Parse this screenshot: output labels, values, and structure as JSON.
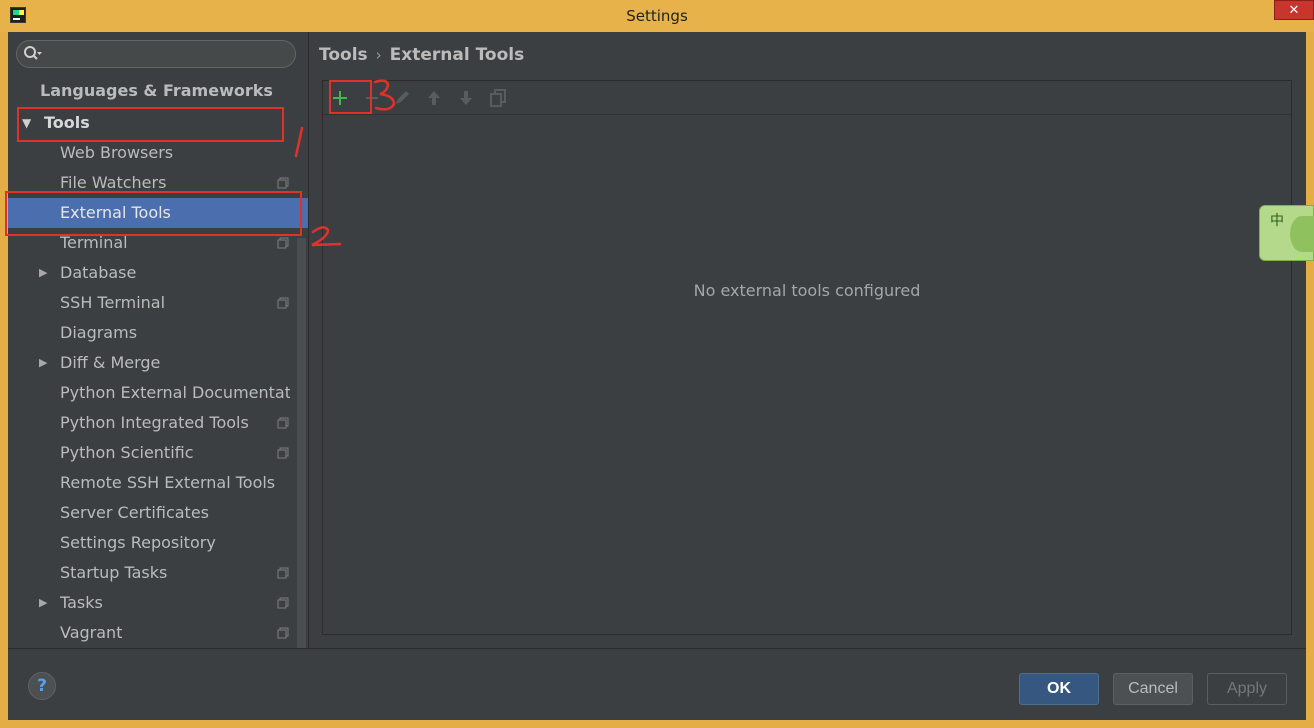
{
  "window": {
    "title": "Settings",
    "close_glyph": "✕"
  },
  "search": {
    "value": ""
  },
  "breadcrumb": {
    "parent": "Tools",
    "separator": "›",
    "current": "External Tools"
  },
  "tree": {
    "languages": "Languages & Frameworks",
    "tools": "Tools",
    "items": [
      {
        "label": "Web Browsers"
      },
      {
        "label": "File Watchers"
      },
      {
        "label": "External Tools"
      },
      {
        "label": "Terminal"
      },
      {
        "label": "Database"
      },
      {
        "label": "SSH Terminal"
      },
      {
        "label": "Diagrams"
      },
      {
        "label": "Diff & Merge"
      },
      {
        "label": "Python External Documentatic"
      },
      {
        "label": "Python Integrated Tools"
      },
      {
        "label": "Python Scientific"
      },
      {
        "label": "Remote SSH External Tools"
      },
      {
        "label": "Server Certificates"
      },
      {
        "label": "Settings Repository"
      },
      {
        "label": "Startup Tasks"
      },
      {
        "label": "Tasks"
      },
      {
        "label": "Vagrant"
      }
    ]
  },
  "panel": {
    "empty_text": "No external tools configured"
  },
  "ime": {
    "char": "中"
  },
  "buttons": {
    "help": "?",
    "ok": "OK",
    "cancel": "Cancel",
    "apply": "Apply"
  },
  "colors": {
    "selection": "#4b6eaf",
    "annotation": "#e0322b",
    "add_icon": "#3fba4a"
  }
}
